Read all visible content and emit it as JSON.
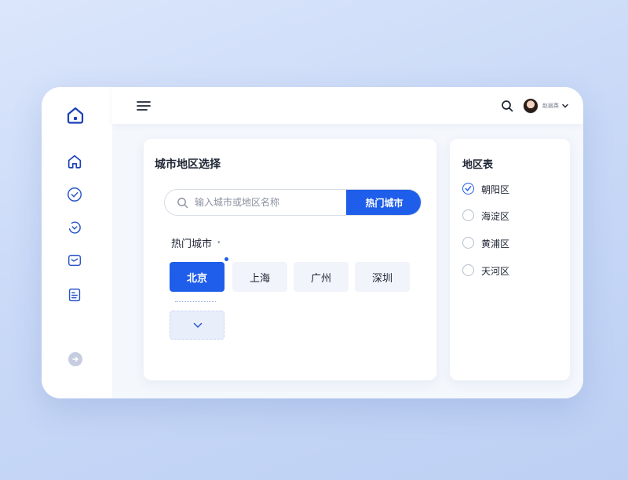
{
  "header": {
    "username": "赵丽英"
  },
  "city_panel": {
    "title": "城市地区选择",
    "search": {
      "placeholder": "输入城市或地区名称",
      "value": ""
    },
    "hot_button_label": "热门城市",
    "section_label": "热门城市",
    "cities": [
      {
        "label": "北京",
        "selected": true
      },
      {
        "label": "上海",
        "selected": false
      },
      {
        "label": "广州",
        "selected": false
      },
      {
        "label": "深圳",
        "selected": false
      }
    ]
  },
  "region_panel": {
    "title": "地区表",
    "items": [
      {
        "label": "朝阳区",
        "checked": true
      },
      {
        "label": "海淀区",
        "checked": false
      },
      {
        "label": "黄浦区",
        "checked": false
      },
      {
        "label": "天河区",
        "checked": false
      }
    ]
  },
  "colors": {
    "accent": "#1f5eea",
    "background": "#c9d9f7"
  }
}
